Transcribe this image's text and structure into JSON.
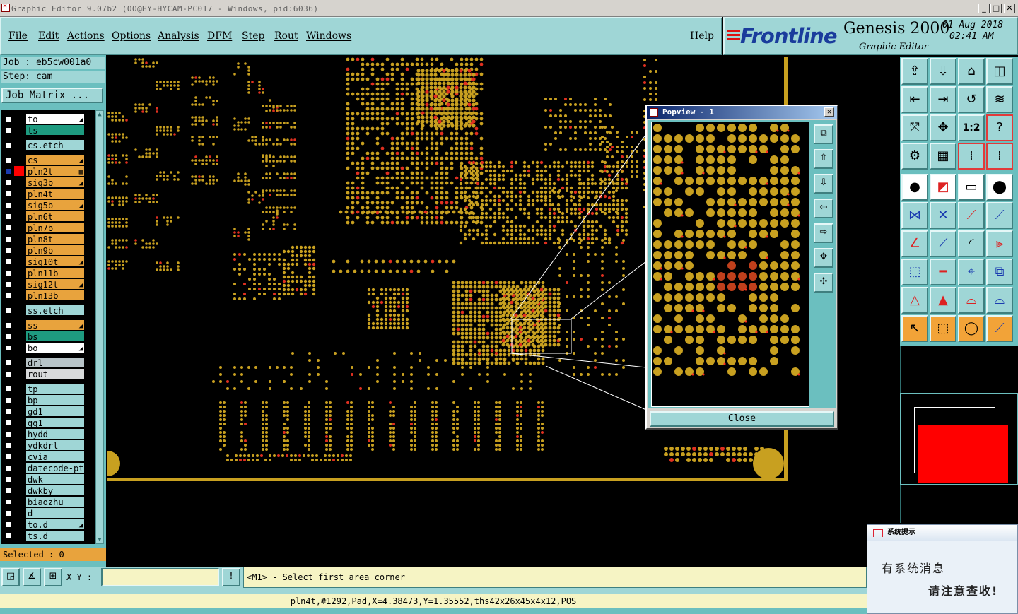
{
  "window": {
    "title": "Graphic Editor 9.07b2 (OO@HY-HYCAM-PC017 - Windows, pid:6036)",
    "minimize": "_",
    "maximize": "□",
    "close": "✕"
  },
  "menu": {
    "items": [
      "File",
      "Edit",
      "Actions",
      "Options",
      "Analysis",
      "DFM",
      "Step",
      "Rout",
      "Windows"
    ],
    "help": "Help"
  },
  "brand": {
    "logo": "Frontline",
    "product": "Genesis 2000",
    "subtitle": "Graphic Editor",
    "date": "01 Aug 2018",
    "time": "02:41 AM"
  },
  "job": {
    "job_line": "Job : eb5cw001a0",
    "step_line": "Step: cam",
    "matrix_button": "Job Matrix ..."
  },
  "layers": [
    {
      "name": "to",
      "color": "#ffffff",
      "mark": "◢"
    },
    {
      "name": "ts",
      "color": "#1e9b80",
      "mark": ""
    },
    {
      "name": "cs.etch",
      "color": "#9fd6d6",
      "mark": ""
    },
    {
      "name": "cs",
      "color": "#e8a33d",
      "mark": "◢"
    },
    {
      "name": "pln2t",
      "color": "#e8a33d",
      "mark": "▦",
      "active": true
    },
    {
      "name": "sig3b",
      "color": "#e8a33d",
      "mark": "◢"
    },
    {
      "name": "pln4t",
      "color": "#e8a33d",
      "mark": ""
    },
    {
      "name": "sig5b",
      "color": "#e8a33d",
      "mark": "◢"
    },
    {
      "name": "pln6t",
      "color": "#e8a33d",
      "mark": ""
    },
    {
      "name": "pln7b",
      "color": "#e8a33d",
      "mark": ""
    },
    {
      "name": "pln8t",
      "color": "#e8a33d",
      "mark": ""
    },
    {
      "name": "pln9b",
      "color": "#e8a33d",
      "mark": ""
    },
    {
      "name": "sig10t",
      "color": "#e8a33d",
      "mark": "◢"
    },
    {
      "name": "pln11b",
      "color": "#e8a33d",
      "mark": ""
    },
    {
      "name": "sig12t",
      "color": "#e8a33d",
      "mark": "◢"
    },
    {
      "name": "pln13b",
      "color": "#e8a33d",
      "mark": ""
    },
    {
      "name": "ss.etch",
      "color": "#9fd6d6",
      "mark": ""
    },
    {
      "name": "ss",
      "color": "#e8a33d",
      "mark": "◢"
    },
    {
      "name": "bs",
      "color": "#1e9b80",
      "mark": ""
    },
    {
      "name": "bo",
      "color": "#ffffff",
      "mark": "◢"
    },
    {
      "name": "drl",
      "color": "#b8c4c8",
      "mark": ""
    },
    {
      "name": "rout",
      "color": "#d8dadb",
      "mark": ""
    },
    {
      "name": "tp",
      "color": "#9fd6d6",
      "mark": ""
    },
    {
      "name": "bp",
      "color": "#9fd6d6",
      "mark": ""
    },
    {
      "name": "gd1",
      "color": "#9fd6d6",
      "mark": ""
    },
    {
      "name": "gg1",
      "color": "#9fd6d6",
      "mark": ""
    },
    {
      "name": "hydd",
      "color": "#9fd6d6",
      "mark": ""
    },
    {
      "name": "ydkdrl",
      "color": "#9fd6d6",
      "mark": ""
    },
    {
      "name": "cvia",
      "color": "#9fd6d6",
      "mark": ""
    },
    {
      "name": "datecode-pt",
      "color": "#9fd6d6",
      "mark": ""
    },
    {
      "name": "dwk",
      "color": "#9fd6d6",
      "mark": ""
    },
    {
      "name": "dwkby",
      "color": "#9fd6d6",
      "mark": ""
    },
    {
      "name": "biaozhu",
      "color": "#9fd6d6",
      "mark": ""
    },
    {
      "name": "d",
      "color": "#9fd6d6",
      "mark": ""
    },
    {
      "name": "to.d",
      "color": "#9fd6d6",
      "mark": "◢"
    },
    {
      "name": "ts.d",
      "color": "#9fd6d6",
      "mark": ""
    }
  ],
  "selected_count": "Selected : 0",
  "popview": {
    "title": "Popview - 1",
    "close_button": "Close"
  },
  "bottom": {
    "xy_label": "X Y :",
    "xy_value": "",
    "prompt": "<M1> - Select first area corner",
    "status": "pln4t,#1292,Pad,X=4.38473,Y=1.35552,ths42x26x45x4x12,POS"
  },
  "notification": {
    "header": "系统提示",
    "line1": "有系统消息",
    "line2": "请注意查收!"
  },
  "colors": {
    "panel": "#9fd6d6",
    "pad": "#c8a020",
    "accent_red": "#ff0000"
  }
}
